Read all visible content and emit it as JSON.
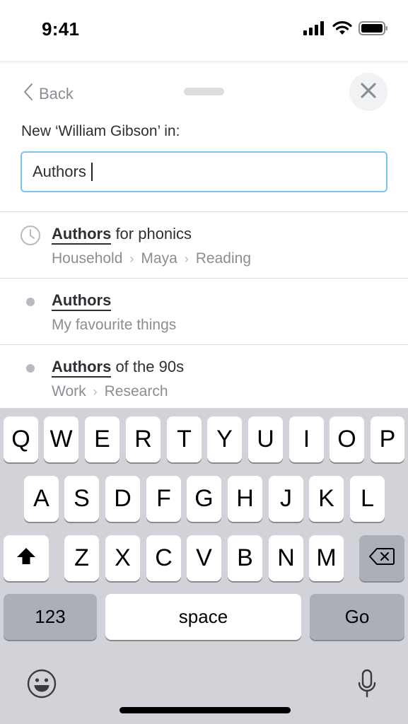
{
  "status_bar": {
    "time": "9:41",
    "icons": [
      "cellular-signal-icon",
      "wifi-icon",
      "battery-icon"
    ]
  },
  "sheet": {
    "back_label": "Back",
    "prompt": "New ‘William Gibson’ in:",
    "input_value": "Authors"
  },
  "results": [
    {
      "icon": "clock-icon",
      "match": "Authors",
      "rest": " for phonics",
      "path": [
        "Household",
        "Maya",
        "Reading"
      ]
    },
    {
      "icon": "bullet-icon",
      "match": "Authors",
      "rest": "",
      "path": [
        "My favourite things"
      ]
    },
    {
      "icon": "bullet-icon",
      "match": "Authors",
      "rest": " of the 90s",
      "path": [
        "Work",
        "Research"
      ]
    }
  ],
  "keyboard": {
    "row1": [
      "Q",
      "W",
      "E",
      "R",
      "T",
      "Y",
      "U",
      "I",
      "O",
      "P"
    ],
    "row2": [
      "A",
      "S",
      "D",
      "F",
      "G",
      "H",
      "J",
      "K",
      "L"
    ],
    "row3": [
      "Z",
      "X",
      "C",
      "V",
      "B",
      "N",
      "M"
    ],
    "numbers_label": "123",
    "space_label": "space",
    "go_label": "Go",
    "icons": [
      "shift-icon",
      "delete-icon",
      "emoji-icon",
      "microphone-icon"
    ]
  },
  "colors": {
    "input_border": "#78c4ec",
    "keyboard_bg": "#d1d3d9",
    "key_dark": "#abafb8"
  }
}
